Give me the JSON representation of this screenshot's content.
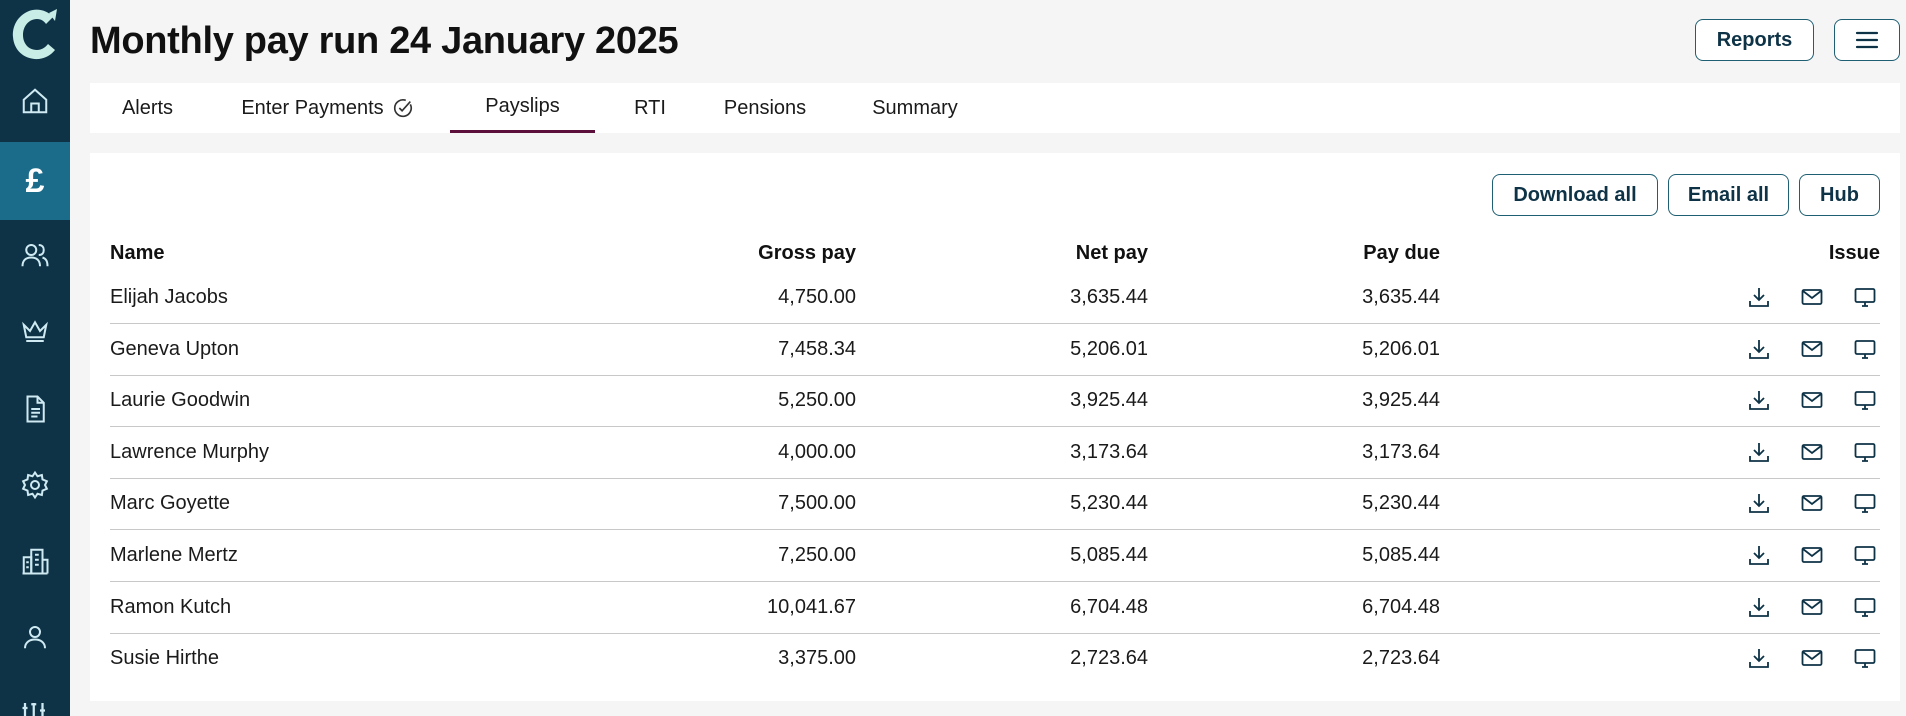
{
  "app": {
    "logo_letter": "C"
  },
  "sidebar": {
    "items": [
      {
        "name": "home-icon"
      },
      {
        "name": "pound-icon",
        "active": true,
        "glyph": "£"
      },
      {
        "name": "people-icon"
      },
      {
        "name": "crown-icon"
      },
      {
        "name": "document-icon"
      },
      {
        "name": "gear-icon"
      },
      {
        "name": "building-icon"
      },
      {
        "name": "person-icon"
      },
      {
        "name": "sliders-icon"
      }
    ]
  },
  "header": {
    "title": "Monthly pay run 24 January 2025",
    "reports_label": "Reports",
    "menu_icon": "hamburger-icon"
  },
  "tabs": [
    {
      "label": "Alerts"
    },
    {
      "label": "Enter Payments",
      "icon": "check-circle-icon"
    },
    {
      "label": "Payslips",
      "active": true
    },
    {
      "label": "RTI"
    },
    {
      "label": "Pensions"
    },
    {
      "label": "Summary"
    }
  ],
  "actions": {
    "download_all": "Download all",
    "email_all": "Email all",
    "hub": "Hub"
  },
  "table": {
    "columns": [
      "Name",
      "Gross pay",
      "Net pay",
      "Pay due",
      "Issue"
    ],
    "rows": [
      {
        "name": "Elijah Jacobs",
        "gross": "4,750.00",
        "net": "3,635.44",
        "due": "3,635.44"
      },
      {
        "name": "Geneva Upton",
        "gross": "7,458.34",
        "net": "5,206.01",
        "due": "5,206.01"
      },
      {
        "name": "Laurie Goodwin",
        "gross": "5,250.00",
        "net": "3,925.44",
        "due": "3,925.44"
      },
      {
        "name": "Lawrence Murphy",
        "gross": "4,000.00",
        "net": "3,173.64",
        "due": "3,173.64"
      },
      {
        "name": "Marc Goyette",
        "gross": "7,500.00",
        "net": "5,230.44",
        "due": "5,230.44"
      },
      {
        "name": "Marlene Mertz",
        "gross": "7,250.00",
        "net": "5,085.44",
        "due": "5,085.44"
      },
      {
        "name": "Ramon Kutch",
        "gross": "10,041.67",
        "net": "6,704.48",
        "due": "6,704.48"
      },
      {
        "name": "Susie Hirthe",
        "gross": "3,375.00",
        "net": "2,723.64",
        "due": "2,723.64"
      }
    ],
    "issue_icons": [
      "download-icon",
      "email-icon",
      "monitor-icon"
    ]
  },
  "colors": {
    "sidebar": "#0e3347",
    "sidebar_active": "#1b6c8a",
    "tab_underline": "#5c0f3b",
    "button_border": "#1f5f73"
  }
}
